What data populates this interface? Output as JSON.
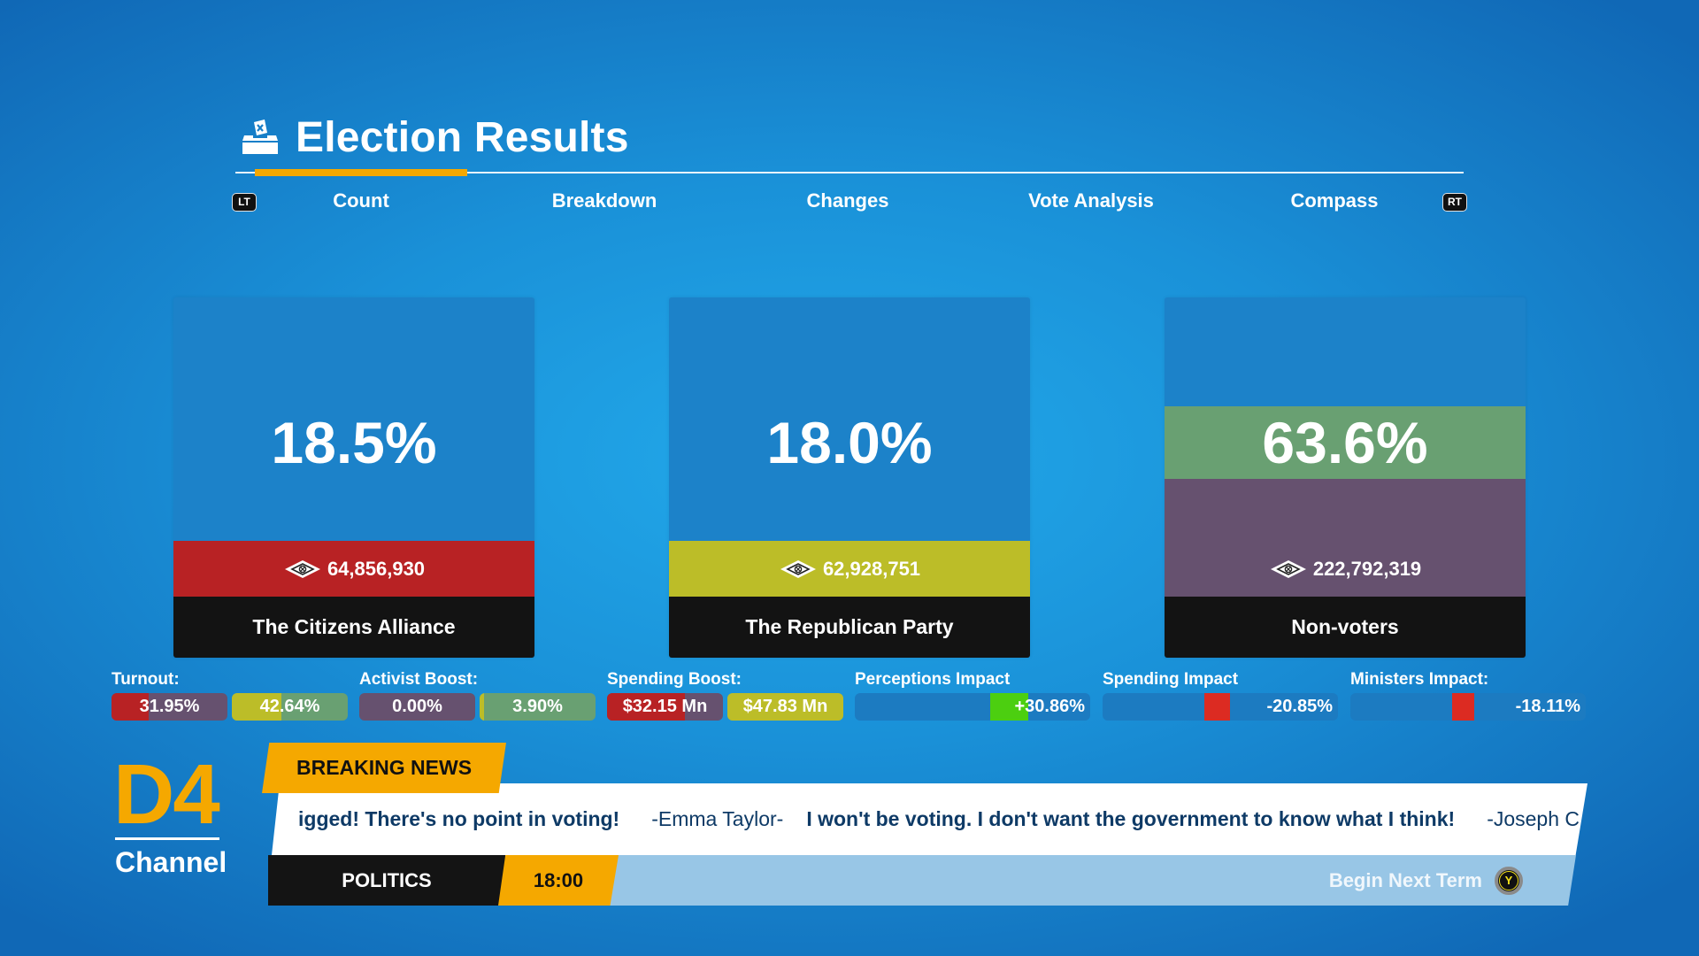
{
  "header": {
    "title": "Election Results",
    "icon": "ballot-box-icon",
    "left_trigger": "LT",
    "right_trigger": "RT",
    "tabs": [
      {
        "label": "Count",
        "active": true
      },
      {
        "label": "Breakdown",
        "active": false
      },
      {
        "label": "Changes",
        "active": false
      },
      {
        "label": "Vote Analysis",
        "active": false
      },
      {
        "label": "Compass",
        "active": false
      }
    ]
  },
  "cards": [
    {
      "name": "The Citizens Alliance",
      "percent": "18.5%",
      "votes": "64,856,930",
      "color": "#b82224"
    },
    {
      "name": "The Republican Party",
      "percent": "18.0%",
      "votes": "62,928,751",
      "color": "#bcbd28"
    },
    {
      "name": "Non-voters",
      "percent": "63.6%",
      "votes": "222,792,319",
      "color_top": "#69a072",
      "color_bottom": "#66516f"
    }
  ],
  "stats": {
    "turnout": {
      "label": "Turnout:",
      "values": [
        {
          "text": "31.95%",
          "fill_fraction": 0.3195,
          "fill_color": "#b82224",
          "bg_color": "#66516f"
        },
        {
          "text": "42.64%",
          "fill_fraction": 0.4264,
          "fill_color": "#bcbd28",
          "bg_color": "#69a072"
        }
      ]
    },
    "activist_boost": {
      "label": "Activist Boost:",
      "values": [
        {
          "text": "0.00%",
          "fill_fraction": 0.0,
          "fill_color": "#b82224",
          "bg_color": "#66516f"
        },
        {
          "text": "3.90%",
          "fill_fraction": 0.039,
          "fill_color": "#bcbd28",
          "bg_color": "#69a072"
        }
      ]
    },
    "spending_boost": {
      "label": "Spending Boost:",
      "values": [
        {
          "text": "$32.15 Mn",
          "fill_fraction": 0.67,
          "fill_color": "#b82224",
          "bg_color": "#66516f"
        },
        {
          "text": "$47.83 Mn",
          "fill_fraction": 1.0,
          "fill_color": "#bcbd28",
          "bg_color": "#69a072"
        }
      ]
    },
    "perceptions_impact": {
      "label": "Perceptions Impact",
      "text": "+30.86%",
      "value": 30.86,
      "color": "#4ccf10"
    },
    "spending_impact": {
      "label": "Spending Impact",
      "text": "-20.85%",
      "value": -20.85,
      "color": "#dc2b22"
    },
    "ministers_impact": {
      "label": "Ministers Impact:",
      "text": "-18.11%",
      "value": -18.11,
      "color": "#dc2b22"
    }
  },
  "news": {
    "channel_logo": "D4",
    "channel_label": "Channel",
    "breaking_label": "BREAKING NEWS",
    "ticker": [
      {
        "quote": "igged! There's no point in voting!",
        "author": "-Emma Taylor-"
      },
      {
        "quote": "I won't be voting. I don't want the government to know what I think!",
        "author": "-Joseph C"
      }
    ],
    "category": "POLITICS",
    "time": "18:00",
    "next_action": "Begin Next Term",
    "next_button": "Y"
  }
}
